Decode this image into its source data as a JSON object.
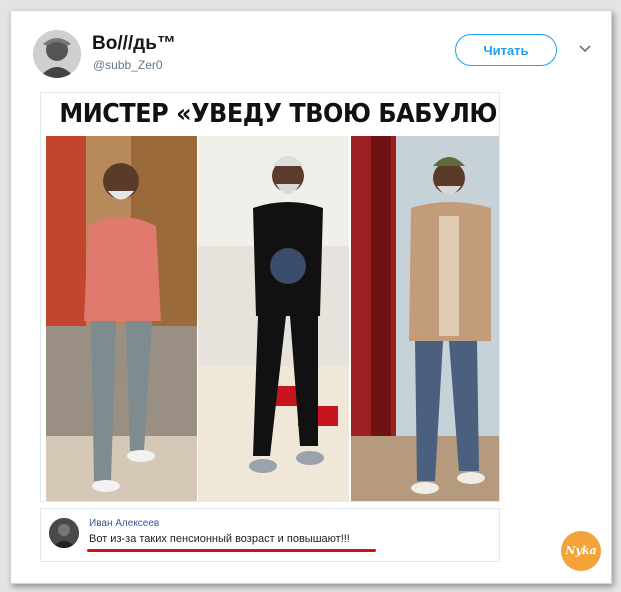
{
  "tweet": {
    "display_name": "Во///дь™",
    "handle": "@subb_Zer0",
    "follow_label": "Читать",
    "menu_icon": "chevron-down-icon"
  },
  "media": {
    "headline": "МИСТЕР «УВЕДУ ТВОЮ БАБУЛЮ»",
    "photos": [
      "photo-1",
      "photo-2",
      "photo-3"
    ],
    "comment": {
      "author": "Иван Алексеев",
      "text": "Вот из-за таких пенсионный возраст и повышают!!!"
    }
  },
  "watermark": {
    "text": "Nyka"
  },
  "colors": {
    "accent": "#1da1f2",
    "underline": "#d0101a",
    "watermark": "#f2a33a"
  }
}
